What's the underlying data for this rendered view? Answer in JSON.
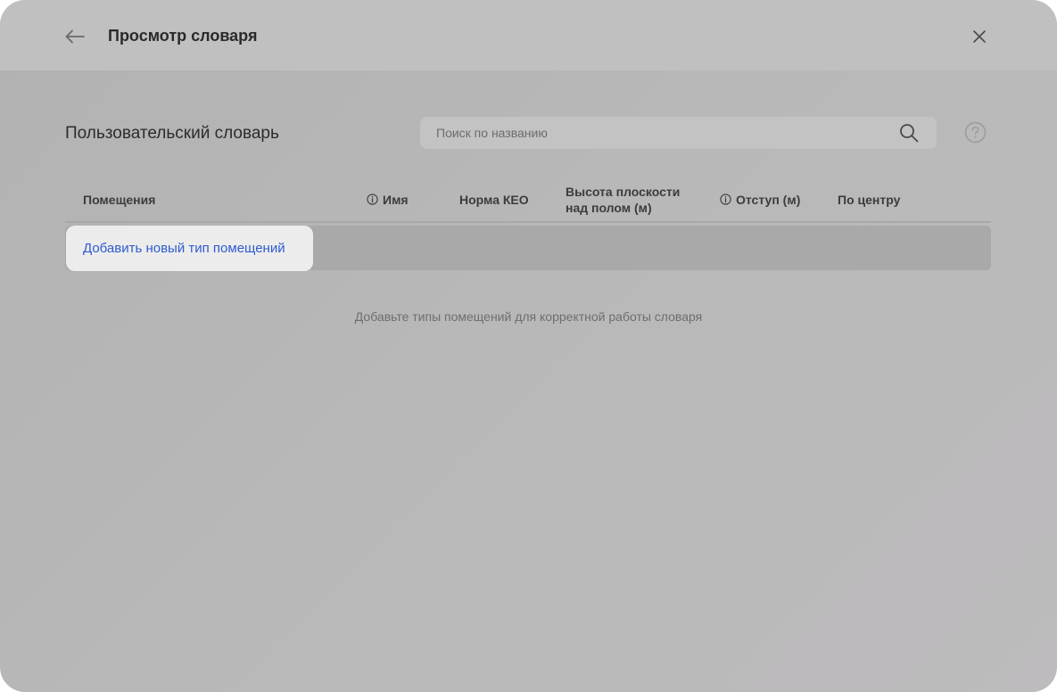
{
  "colors": {
    "header_bg": "#c0c0c0",
    "overlay_bg": "#b6b6b6",
    "link": "#2f5bd0",
    "text_primary": "#2a2a2a",
    "text_muted": "#6e6e6e"
  },
  "header": {
    "back_icon": "arrow-left-icon",
    "title": "Просмотр словаря",
    "close_icon": "close-icon"
  },
  "section": {
    "title": "Пользовательский словарь"
  },
  "search": {
    "placeholder": "Поиск по названию",
    "value": "",
    "icon": "search-icon"
  },
  "help": {
    "icon": "help-icon"
  },
  "table": {
    "columns": [
      {
        "label": "Помещения",
        "info": false
      },
      {
        "label": "Имя",
        "info": true
      },
      {
        "label": "Норма КЕО",
        "info": false
      },
      {
        "label_line1": "Высота плоскости",
        "label_line2": "над полом (м)",
        "info": false
      },
      {
        "label": "Отступ (м)",
        "info": true
      },
      {
        "label": "По центру",
        "info": false
      }
    ],
    "add_row_label": "Добавить новый тип помещений",
    "empty_message": "Добавьте типы помещений для корректной работы словаря"
  }
}
